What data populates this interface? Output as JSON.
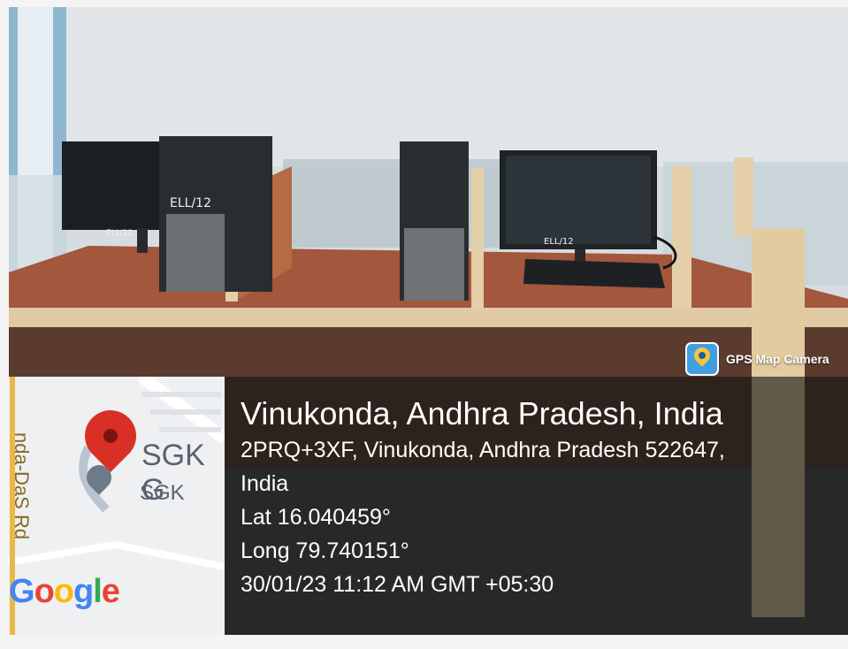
{
  "badge": {
    "text": "GPS Map Camera",
    "icon": "map-pin-icon",
    "icon_color": "#3f9fe0"
  },
  "location": {
    "title": "Vinukonda, Andhra Pradesh, India",
    "address_line1": "2PRQ+3XF, Vinukonda, Andhra Pradesh 522647,",
    "address_line2": "India",
    "lat": "Lat 16.040459°",
    "long": "Long 79.740151°",
    "datetime": "30/01/23 11:12 AM GMT +05:30"
  },
  "map": {
    "place_label_large": "SGK G",
    "place_label_small": "SGK",
    "road_label": "nda-DaS Rd",
    "logo": "Google",
    "pin_color": "#d93025"
  },
  "scene": {
    "monitor_labels": [
      "ELL/12",
      "ELL/12",
      "ELL/12"
    ]
  }
}
